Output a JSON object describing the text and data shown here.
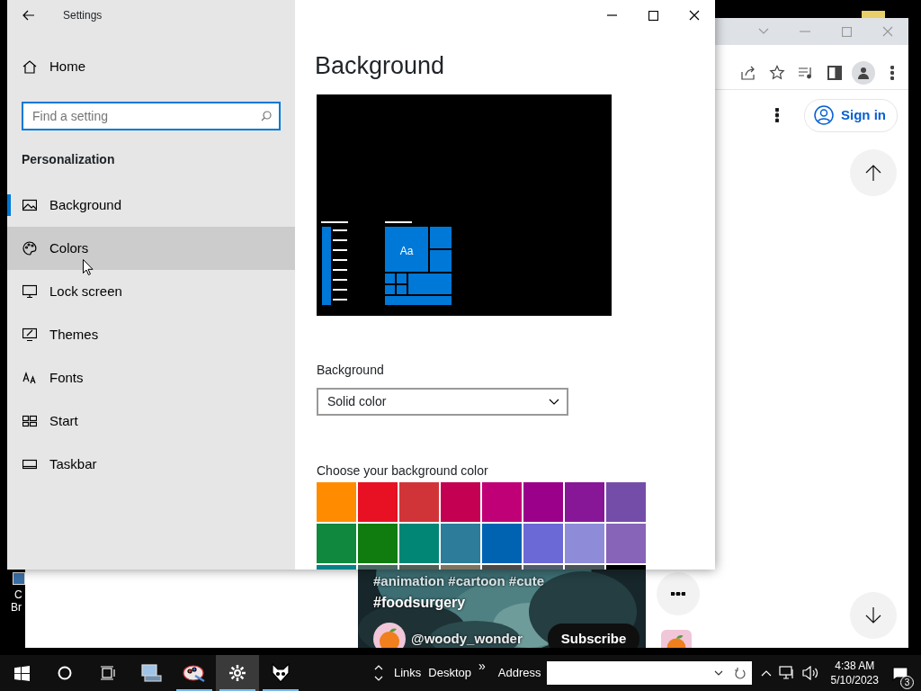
{
  "desktop": {
    "icon_label_lines": [
      "C",
      "Br"
    ]
  },
  "browser": {
    "sign_in": "Sign in",
    "video": {
      "hashtags": "#animation #cartoon #cute",
      "hashtag_2": "#foodsurgery",
      "channel": "@woody_wonder",
      "subscribe": "Subscribe"
    }
  },
  "settings": {
    "title": "Settings",
    "home": "Home",
    "search": {
      "placeholder": "Find a setting"
    },
    "section": "Personalization",
    "nav": [
      {
        "label": "Background",
        "selected": true,
        "hovered": false
      },
      {
        "label": "Colors",
        "selected": false,
        "hovered": true
      },
      {
        "label": "Lock screen",
        "selected": false,
        "hovered": false
      },
      {
        "label": "Themes",
        "selected": false,
        "hovered": false
      },
      {
        "label": "Fonts",
        "selected": false,
        "hovered": false
      },
      {
        "label": "Start",
        "selected": false,
        "hovered": false
      },
      {
        "label": "Taskbar",
        "selected": false,
        "hovered": false
      }
    ],
    "page_title": "Background",
    "preview": {
      "tile_text": "Aa"
    },
    "background_label": "Background",
    "background_value": "Solid color",
    "color_label": "Choose your background color",
    "swatches": [
      {
        "color": "#ff8c00"
      },
      {
        "color": "#e81123"
      },
      {
        "color": "#d13438"
      },
      {
        "color": "#c30052"
      },
      {
        "color": "#bf0077"
      },
      {
        "color": "#9a0089"
      },
      {
        "color": "#881798"
      },
      {
        "color": "#744da9"
      },
      {
        "color": "#10893e"
      },
      {
        "color": "#107c10"
      },
      {
        "color": "#018574"
      },
      {
        "color": "#2d7d9a"
      },
      {
        "color": "#0063b1"
      },
      {
        "color": "#6b69d6"
      },
      {
        "color": "#8e8cd8"
      },
      {
        "color": "#8764b8"
      },
      {
        "color": "#038387"
      },
      {
        "color": "#486860"
      },
      {
        "color": "#525e54"
      },
      {
        "color": "#7e735f"
      },
      {
        "color": "#4c4a48"
      },
      {
        "color": "#515c6b"
      },
      {
        "color": "#4a5459"
      },
      {
        "color": "#000000"
      }
    ]
  },
  "taskbar": {
    "apps": [
      {
        "running": false,
        "active": false
      },
      {
        "running": true,
        "active": false
      },
      {
        "running": true,
        "active": true
      },
      {
        "running": true,
        "active": false
      }
    ],
    "toolbar_links": [
      "Links",
      "Desktop"
    ],
    "overflow": "»",
    "address_label": "Address",
    "clock_time": "4:38 AM",
    "clock_date": "5/10/2023",
    "notification_count": "3"
  }
}
